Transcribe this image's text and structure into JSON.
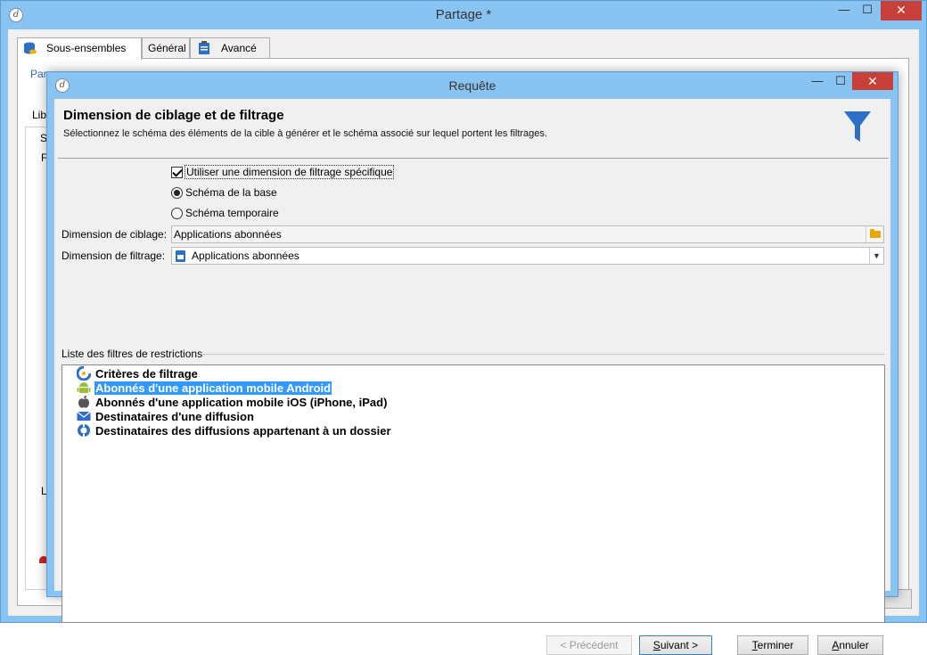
{
  "outer_window": {
    "title": "Partage *",
    "controls": {
      "minimize": "—",
      "maximize": "☐",
      "close": "✕"
    },
    "tabs": [
      {
        "label": "Sous-ensembles",
        "icon": "database-icon",
        "active": true
      },
      {
        "label": "Général",
        "active": false
      },
      {
        "label": "Avancé",
        "icon": "clipboard-icon",
        "active": false
      }
    ],
    "background_fragments": {
      "para": "Para",
      "lib": "Libe",
      "s": "S",
      "f": "F",
      "l": "L"
    }
  },
  "dialog": {
    "title": "Requête",
    "controls": {
      "minimize": "—",
      "maximize": "☐",
      "close": "✕"
    },
    "close_color": "#c7403a",
    "header": {
      "title": "Dimension de ciblage et de filtrage",
      "subtitle": "Sélectionnez le schéma des éléments de la cible à générer et le schéma associé sur lequel portent les filtrages.",
      "icon": "funnel-icon",
      "icon_color": "#2e6fc6"
    },
    "options": {
      "use_filter_dimension": {
        "label": "Utiliser une dimension de filtrage spécifique",
        "checked": true
      },
      "radio_base": {
        "label": "Schéma de la base",
        "checked": true
      },
      "radio_temp": {
        "label": "Schéma temporaire",
        "checked": false
      }
    },
    "fields": {
      "targeting": {
        "label": "Dimension de ciblage:",
        "value": "Applications abonnées"
      },
      "filtering": {
        "label": "Dimension de filtrage:",
        "value": "Applications abonnées"
      }
    },
    "filters_group": {
      "label": "Liste des filtres de restrictions",
      "items": [
        {
          "label": "Critères de filtrage",
          "icon": "filter-criteria-icon",
          "selected": false
        },
        {
          "label": "Abonnés d'une application mobile Android",
          "icon": "android-icon",
          "selected": true
        },
        {
          "label": "Abonnés d'une application mobile iOS (iPhone, iPad)",
          "icon": "apple-icon",
          "selected": false
        },
        {
          "label": "Destinataires d'une diffusion",
          "icon": "envelope-icon",
          "selected": false
        },
        {
          "label": "Destinataires des diffusions appartenant à un dossier",
          "icon": "folder-delivery-icon",
          "selected": false
        }
      ]
    },
    "buttons": {
      "previous": "< Précédent",
      "next": "Suivant >",
      "finish": "Terminer",
      "cancel": "Annuler"
    }
  },
  "colors": {
    "window_frame": "#89c3f2",
    "selection": "#3399ff",
    "accent": "#2e6fc6"
  }
}
